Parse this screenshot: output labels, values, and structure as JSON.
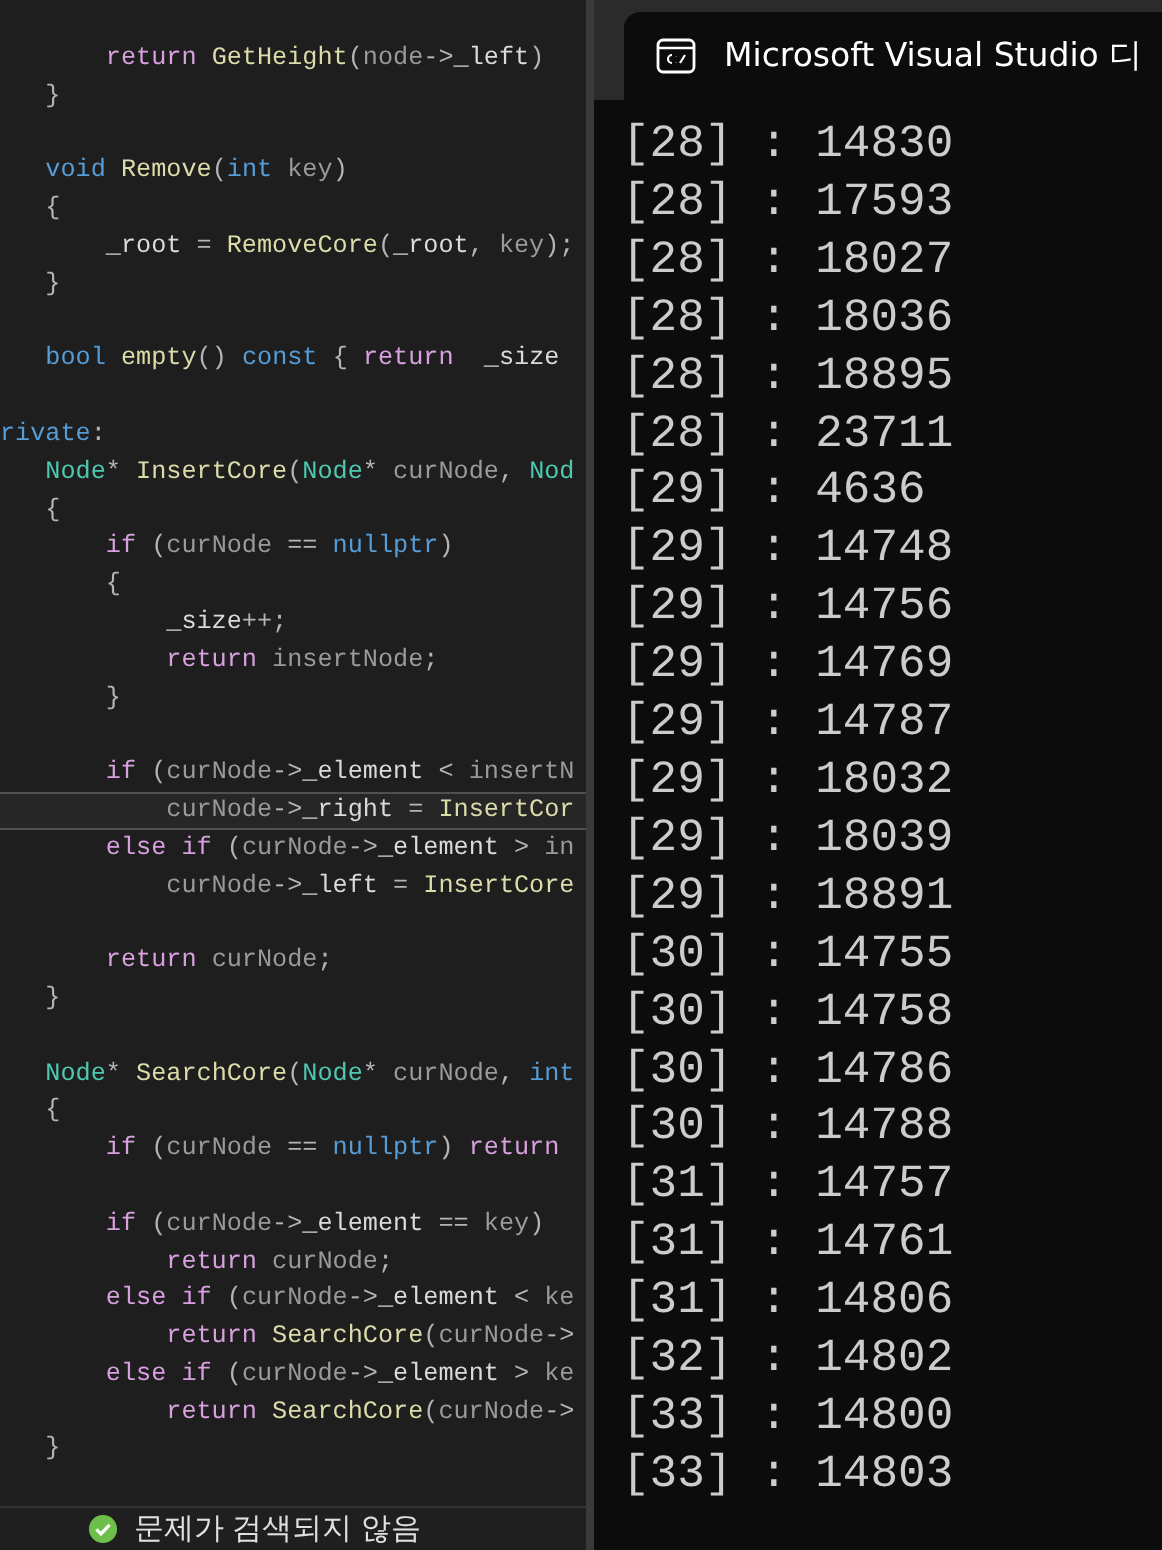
{
  "editor": {
    "blocks": [
      {
        "lines": [
          {
            "current": false,
            "tokens": [
              {
                "kind": "kw",
                "text": "       return "
              },
              {
                "kind": "fn",
                "text": "GetHeight"
              },
              {
                "kind": "p",
                "text": "("
              },
              {
                "kind": "var",
                "text": "node"
              },
              {
                "kind": "p",
                "text": "->"
              },
              {
                "kind": "mem",
                "text": "_left"
              },
              {
                "kind": "p",
                "text": ") "
              }
            ]
          },
          {
            "current": false,
            "tokens": [
              {
                "kind": "p",
                "text": "   }"
              }
            ]
          }
        ]
      },
      {
        "lines": [
          {
            "current": false,
            "tokens": [
              {
                "kind": "type",
                "text": "   void "
              },
              {
                "kind": "fn",
                "text": "Remove"
              },
              {
                "kind": "p",
                "text": "("
              },
              {
                "kind": "type",
                "text": "int "
              },
              {
                "kind": "var",
                "text": "key"
              },
              {
                "kind": "p",
                "text": ")"
              }
            ]
          },
          {
            "current": false,
            "tokens": [
              {
                "kind": "p",
                "text": "   {"
              }
            ]
          },
          {
            "current": false,
            "tokens": [
              {
                "kind": "mem",
                "text": "       _root "
              },
              {
                "kind": "p",
                "text": "= "
              },
              {
                "kind": "fn",
                "text": "RemoveCore"
              },
              {
                "kind": "p",
                "text": "("
              },
              {
                "kind": "mem",
                "text": "_root"
              },
              {
                "kind": "p",
                "text": ", "
              },
              {
                "kind": "var",
                "text": "key"
              },
              {
                "kind": "p",
                "text": ");"
              }
            ]
          },
          {
            "current": false,
            "tokens": [
              {
                "kind": "p",
                "text": "   }"
              }
            ]
          }
        ]
      },
      {
        "lines": [
          {
            "current": false,
            "tokens": [
              {
                "kind": "type",
                "text": "   bool "
              },
              {
                "kind": "fn",
                "text": "empty"
              },
              {
                "kind": "p",
                "text": "() "
              },
              {
                "kind": "type",
                "text": "const "
              },
              {
                "kind": "p",
                "text": "{ "
              },
              {
                "kind": "kw",
                "text": "return  "
              },
              {
                "kind": "mem",
                "text": "_size"
              }
            ]
          }
        ]
      },
      {
        "lines": [
          {
            "current": false,
            "tokens": [
              {
                "kind": "type",
                "text": "rivate"
              },
              {
                "kind": "p",
                "text": ":"
              }
            ]
          },
          {
            "current": false,
            "tokens": [
              {
                "kind": "cls",
                "text": "   Node"
              },
              {
                "kind": "p",
                "text": "* "
              },
              {
                "kind": "fn",
                "text": "InsertCore"
              },
              {
                "kind": "p",
                "text": "("
              },
              {
                "kind": "cls",
                "text": "Node"
              },
              {
                "kind": "p",
                "text": "* "
              },
              {
                "kind": "var",
                "text": "curNode"
              },
              {
                "kind": "p",
                "text": ", "
              },
              {
                "kind": "cls",
                "text": "Nod"
              }
            ]
          },
          {
            "current": false,
            "tokens": [
              {
                "kind": "p",
                "text": "   {"
              }
            ]
          },
          {
            "current": false,
            "tokens": [
              {
                "kind": "kw",
                "text": "       if "
              },
              {
                "kind": "p",
                "text": "("
              },
              {
                "kind": "var",
                "text": "curNode "
              },
              {
                "kind": "p",
                "text": "== "
              },
              {
                "kind": "type",
                "text": "nullptr"
              },
              {
                "kind": "p",
                "text": ")"
              }
            ]
          },
          {
            "current": false,
            "tokens": [
              {
                "kind": "p",
                "text": "       {"
              }
            ]
          },
          {
            "current": false,
            "tokens": [
              {
                "kind": "mem",
                "text": "           _size"
              },
              {
                "kind": "p",
                "text": "++;"
              }
            ]
          },
          {
            "current": false,
            "tokens": [
              {
                "kind": "kw",
                "text": "           return "
              },
              {
                "kind": "var",
                "text": "insertNode"
              },
              {
                "kind": "p",
                "text": ";"
              }
            ]
          },
          {
            "current": false,
            "tokens": [
              {
                "kind": "p",
                "text": "       }"
              }
            ]
          }
        ]
      },
      {
        "lines": [
          {
            "current": false,
            "tokens": [
              {
                "kind": "kw",
                "text": "       if "
              },
              {
                "kind": "p",
                "text": "("
              },
              {
                "kind": "var",
                "text": "curNode"
              },
              {
                "kind": "p",
                "text": "->"
              },
              {
                "kind": "mem",
                "text": "_element "
              },
              {
                "kind": "p",
                "text": "< "
              },
              {
                "kind": "var",
                "text": "insertN"
              }
            ]
          },
          {
            "current": true,
            "tokens": [
              {
                "kind": "var",
                "text": "           curNode"
              },
              {
                "kind": "p",
                "text": "->"
              },
              {
                "kind": "mem",
                "text": "_right "
              },
              {
                "kind": "p",
                "text": "= "
              },
              {
                "kind": "fn",
                "text": "InsertCor"
              }
            ]
          },
          {
            "current": false,
            "tokens": [
              {
                "kind": "kw",
                "text": "       else if "
              },
              {
                "kind": "p",
                "text": "("
              },
              {
                "kind": "var",
                "text": "curNode"
              },
              {
                "kind": "p",
                "text": "->"
              },
              {
                "kind": "mem",
                "text": "_element "
              },
              {
                "kind": "p",
                "text": "> "
              },
              {
                "kind": "var",
                "text": "in"
              }
            ]
          },
          {
            "current": false,
            "tokens": [
              {
                "kind": "var",
                "text": "           curNode"
              },
              {
                "kind": "p",
                "text": "->"
              },
              {
                "kind": "mem",
                "text": "_left "
              },
              {
                "kind": "p",
                "text": "= "
              },
              {
                "kind": "fn",
                "text": "InsertCore"
              }
            ]
          }
        ]
      },
      {
        "lines": [
          {
            "current": false,
            "tokens": [
              {
                "kind": "kw",
                "text": "       return "
              },
              {
                "kind": "var",
                "text": "curNode"
              },
              {
                "kind": "p",
                "text": ";"
              }
            ]
          },
          {
            "current": false,
            "tokens": [
              {
                "kind": "p",
                "text": "   }"
              }
            ]
          }
        ]
      },
      {
        "lines": [
          {
            "current": false,
            "tokens": [
              {
                "kind": "cls",
                "text": "   Node"
              },
              {
                "kind": "p",
                "text": "* "
              },
              {
                "kind": "fn",
                "text": "SearchCore"
              },
              {
                "kind": "p",
                "text": "("
              },
              {
                "kind": "cls",
                "text": "Node"
              },
              {
                "kind": "p",
                "text": "* "
              },
              {
                "kind": "var",
                "text": "curNode"
              },
              {
                "kind": "p",
                "text": ", "
              },
              {
                "kind": "type",
                "text": "int"
              }
            ]
          },
          {
            "current": false,
            "tokens": [
              {
                "kind": "p",
                "text": "   {"
              }
            ]
          },
          {
            "current": false,
            "tokens": [
              {
                "kind": "kw",
                "text": "       if "
              },
              {
                "kind": "p",
                "text": "("
              },
              {
                "kind": "var",
                "text": "curNode "
              },
              {
                "kind": "p",
                "text": "== "
              },
              {
                "kind": "type",
                "text": "nullptr"
              },
              {
                "kind": "p",
                "text": ") "
              },
              {
                "kind": "kw",
                "text": "return"
              }
            ]
          }
        ]
      },
      {
        "lines": [
          {
            "current": false,
            "tokens": [
              {
                "kind": "kw",
                "text": "       if "
              },
              {
                "kind": "p",
                "text": "("
              },
              {
                "kind": "var",
                "text": "curNode"
              },
              {
                "kind": "p",
                "text": "->"
              },
              {
                "kind": "mem",
                "text": "_element "
              },
              {
                "kind": "p",
                "text": "== "
              },
              {
                "kind": "var",
                "text": "key"
              },
              {
                "kind": "p",
                "text": ")"
              }
            ]
          },
          {
            "current": false,
            "tokens": [
              {
                "kind": "kw",
                "text": "           return "
              },
              {
                "kind": "var",
                "text": "curNode"
              },
              {
                "kind": "p",
                "text": ";"
              }
            ]
          },
          {
            "current": false,
            "tokens": [
              {
                "kind": "kw",
                "text": "       else if "
              },
              {
                "kind": "p",
                "text": "("
              },
              {
                "kind": "var",
                "text": "curNode"
              },
              {
                "kind": "p",
                "text": "->"
              },
              {
                "kind": "mem",
                "text": "_element "
              },
              {
                "kind": "p",
                "text": "< "
              },
              {
                "kind": "var",
                "text": "ke"
              }
            ]
          },
          {
            "current": false,
            "tokens": [
              {
                "kind": "kw",
                "text": "           return "
              },
              {
                "kind": "fn",
                "text": "SearchCore"
              },
              {
                "kind": "p",
                "text": "("
              },
              {
                "kind": "var",
                "text": "curNode"
              },
              {
                "kind": "p",
                "text": "->"
              }
            ]
          },
          {
            "current": false,
            "tokens": [
              {
                "kind": "kw",
                "text": "       else if "
              },
              {
                "kind": "p",
                "text": "("
              },
              {
                "kind": "var",
                "text": "curNode"
              },
              {
                "kind": "p",
                "text": "->"
              },
              {
                "kind": "mem",
                "text": "_element "
              },
              {
                "kind": "p",
                "text": "> "
              },
              {
                "kind": "var",
                "text": "ke"
              }
            ]
          },
          {
            "current": false,
            "tokens": [
              {
                "kind": "kw",
                "text": "           return "
              },
              {
                "kind": "fn",
                "text": "SearchCore"
              },
              {
                "kind": "p",
                "text": "("
              },
              {
                "kind": "var",
                "text": "curNode"
              },
              {
                "kind": "p",
                "text": "->"
              }
            ]
          },
          {
            "current": false,
            "tokens": [
              {
                "kind": "p",
                "text": "   }"
              }
            ]
          }
        ]
      }
    ]
  },
  "status_bar": {
    "message": "문제가 검색되지 않음"
  },
  "console": {
    "title": "Microsoft Visual Studio 디",
    "lines": [
      "[28] : 14830",
      "[28] : 17593",
      "[28] : 18027",
      "[28] : 18036",
      "[28] : 18895",
      "[28] : 23711",
      "[29] : 4636",
      "[29] : 14748",
      "[29] : 14756",
      "[29] : 14769",
      "[29] : 14787",
      "[29] : 18032",
      "[29] : 18039",
      "[29] : 18891",
      "[30] : 14755",
      "[30] : 14758",
      "[30] : 14786",
      "[30] : 14788",
      "[31] : 14757",
      "[31] : 14761",
      "[31] : 14806",
      "[32] : 14802",
      "[33] : 14800",
      "[33] : 14803"
    ]
  }
}
